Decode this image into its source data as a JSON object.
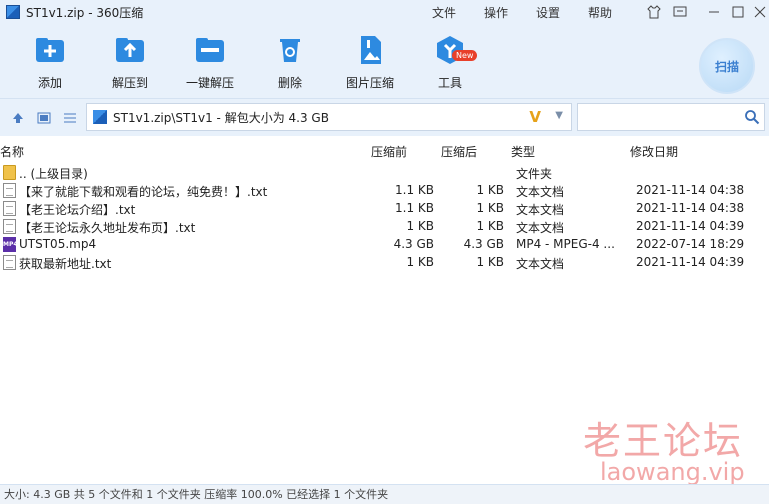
{
  "window": {
    "title": "ST1v1.zip - 360压缩",
    "menus": [
      "文件",
      "操作",
      "设置",
      "帮助"
    ]
  },
  "toolbar": {
    "add": "添加",
    "extract_to": "解压到",
    "one_click_extract": "一键解压",
    "delete": "删除",
    "image_compress": "图片压缩",
    "tools": "工具",
    "new_badge": "New",
    "scan": "扫描"
  },
  "address": {
    "path": "ST1v1.zip\\ST1v1 - 解包大小为 4.3 GB",
    "search_placeholder": ""
  },
  "columns": {
    "name": "名称",
    "compressed_before": "压缩前",
    "compressed_after": "压缩后",
    "type": "类型",
    "modified": "修改日期"
  },
  "files": [
    {
      "name": ".. (上级目录)",
      "before": "",
      "after": "",
      "type": "文件夹",
      "date": ""
    },
    {
      "name": "【来了就能下载和观看的论坛，纯免费！】.txt",
      "before": "1.1 KB",
      "after": "1 KB",
      "type": "文本文档",
      "date": "2021-11-14 04:38"
    },
    {
      "name": "【老王论坛介绍】.txt",
      "before": "1.1 KB",
      "after": "1 KB",
      "type": "文本文档",
      "date": "2021-11-14 04:38"
    },
    {
      "name": "【老王论坛永久地址发布页】.txt",
      "before": "1 KB",
      "after": "1 KB",
      "type": "文本文档",
      "date": "2021-11-14 04:39"
    },
    {
      "name": "UTST05.mp4",
      "before": "4.3 GB",
      "after": "4.3 GB",
      "type": "MP4 - MPEG-4 ...",
      "date": "2022-07-14 18:29"
    },
    {
      "name": "获取最新地址.txt",
      "before": "1 KB",
      "after": "1 KB",
      "type": "文本文档",
      "date": "2021-11-14 04:39"
    }
  ],
  "status": "大小: 4.3 GB 共 5 个文件和 1 个文件夹 压缩率 100.0% 已经选择 1 个文件夹",
  "watermark": {
    "cn": "老王论坛",
    "en": "laowang.vip"
  }
}
